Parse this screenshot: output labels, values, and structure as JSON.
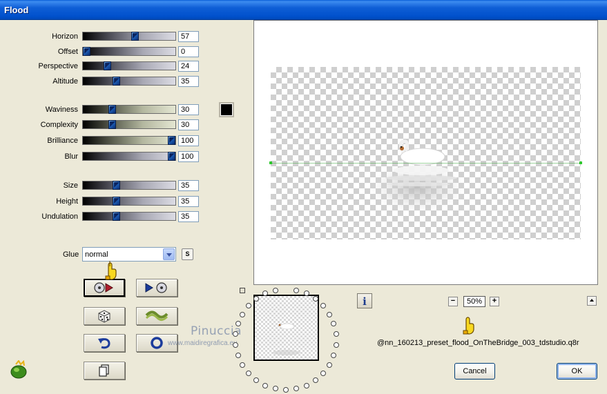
{
  "window": {
    "title": "Flood"
  },
  "sliders_group1": [
    {
      "label": "Horizon",
      "value": "57",
      "fraction": 0.57,
      "style": "grey"
    },
    {
      "label": "Offset",
      "value": "0",
      "fraction": 0.0,
      "style": "grey"
    },
    {
      "label": "Perspective",
      "value": "24",
      "fraction": 0.24,
      "style": "grey"
    },
    {
      "label": "Altitude",
      "value": "35",
      "fraction": 0.35,
      "style": "grey"
    }
  ],
  "sliders_group2": [
    {
      "label": "Waviness",
      "value": "30",
      "fraction": 0.3,
      "style": "green"
    },
    {
      "label": "Complexity",
      "value": "30",
      "fraction": 0.3,
      "style": "green"
    },
    {
      "label": "Brilliance",
      "value": "100",
      "fraction": 1.0,
      "style": "green"
    },
    {
      "label": "Blur",
      "value": "100",
      "fraction": 1.0,
      "style": "grey"
    }
  ],
  "sliders_group3": [
    {
      "label": "Size",
      "value": "35",
      "fraction": 0.35,
      "style": "grey"
    },
    {
      "label": "Height",
      "value": "35",
      "fraction": 0.35,
      "style": "grey"
    },
    {
      "label": "Undulation",
      "value": "35",
      "fraction": 0.35,
      "style": "grey"
    }
  ],
  "color_swatch": "#000000",
  "glue": {
    "label": "Glue",
    "value": "normal",
    "seed_button": "S"
  },
  "tool_buttons": [
    {
      "name": "preset-back-button",
      "icon": "disc-arrow-right-icon"
    },
    {
      "name": "preset-forward-button",
      "icon": "arrow-disc-icon"
    },
    {
      "name": "randomize-button",
      "icon": "dice-icon"
    },
    {
      "name": "wave-button",
      "icon": "wave-icon"
    },
    {
      "name": "reset-button",
      "icon": "undo-arrow-icon"
    },
    {
      "name": "ring-button",
      "icon": "ring-icon"
    },
    {
      "name": "copy-button",
      "icon": "pages-icon"
    }
  ],
  "watermark": {
    "line1": "Pinuccia",
    "line2": "www.maidiregrafica.eu"
  },
  "info_label": "i",
  "zoom": {
    "minus": "−",
    "value": "50%",
    "plus": "+"
  },
  "preset_file": "@nn_160213_preset_flood_OnTheBridge_003_tdstudio.q8r",
  "buttons": {
    "cancel": "Cancel",
    "ok": "OK"
  },
  "colors": {
    "titlebar": "#0054e3",
    "face": "#ece9d8",
    "accent": "#1c5cb4",
    "horizon": "#2ec82e"
  }
}
